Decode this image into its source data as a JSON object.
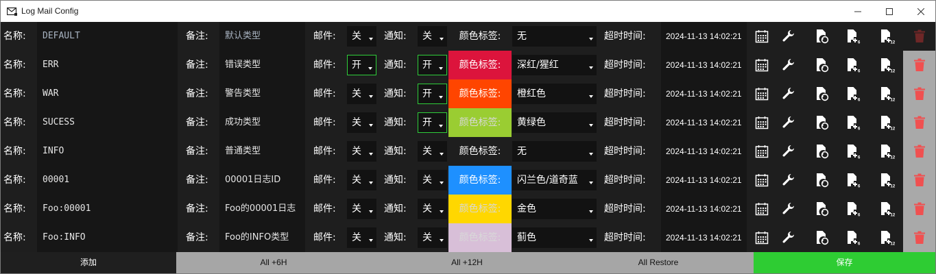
{
  "window": {
    "title": "Log Mail Config",
    "icon": "mail-icon"
  },
  "labels": {
    "name": "名称:",
    "note": "备注:",
    "mail": "邮件:",
    "notify": "通知:",
    "color_label": "颜色标签:",
    "timeout": "超时时间:"
  },
  "rows": [
    {
      "name": "DEFAULT",
      "note": "默认类型",
      "mail": "关",
      "notify": "关",
      "color": "无",
      "color_hex": "",
      "time": "2024-11-13 14:02:21",
      "deletable": false
    },
    {
      "name": "ERR",
      "note": "错误类型",
      "mail": "开",
      "notify": "开",
      "color": "深红/猩红",
      "color_hex": "#dc143c",
      "time": "2024-11-13 14:02:21",
      "deletable": true
    },
    {
      "name": "WAR",
      "note": "警告类型",
      "mail": "关",
      "notify": "开",
      "color": "橙红色",
      "color_hex": "#ff4500",
      "time": "2024-11-13 14:02:21",
      "deletable": true
    },
    {
      "name": "SUCESS",
      "note": "成功类型",
      "mail": "关",
      "notify": "开",
      "color": "黄绿色",
      "color_hex": "#9acd32",
      "time": "2024-11-13 14:02:21",
      "deletable": true
    },
    {
      "name": "INFO",
      "note": "普通类型",
      "mail": "关",
      "notify": "关",
      "color": "无",
      "color_hex": "",
      "time": "2024-11-13 14:02:21",
      "deletable": true
    },
    {
      "name": "00001",
      "note": "00001日志ID",
      "mail": "关",
      "notify": "关",
      "color": "闪兰色/道奇蓝",
      "color_hex": "#1e90ff",
      "time": "2024-11-13 14:02:21",
      "deletable": true
    },
    {
      "name": "Foo:00001",
      "note": "Foo的00001日志",
      "mail": "关",
      "notify": "关",
      "color": "金色",
      "color_hex": "#ffd700",
      "time": "2024-11-13 14:02:21",
      "deletable": true
    },
    {
      "name": "Foo:INFO",
      "note": "Foo的INFO类型",
      "mail": "关",
      "notify": "关",
      "color": "蓟色",
      "color_hex": "#d8bfd8",
      "time": "2024-11-13 14:02:21",
      "deletable": true
    }
  ],
  "icons": {
    "calendar": "calendar-icon",
    "wrench": "wrench-icon",
    "restore": "restore-file-icon",
    "plus6": "plus-6h-icon",
    "plus12": "plus-12h-icon",
    "delete": "trash-icon"
  },
  "footer": {
    "add": "添加",
    "all_6h": "All +6H",
    "all_12h": "All +12H",
    "all_restore": "All Restore",
    "save": "保存"
  },
  "colors": {
    "accent_green": "#2ecc33",
    "toggle_on_border": "#2fcf3a",
    "delete_red": "#f05050"
  }
}
